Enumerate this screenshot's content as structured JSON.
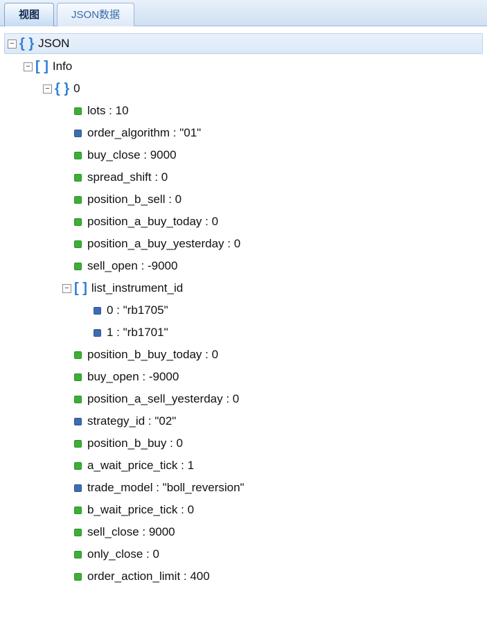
{
  "tabs": {
    "view": "视图",
    "json_data": "JSON数据"
  },
  "tree": {
    "root_label": "JSON",
    "info_label": "Info",
    "index0_label": "0",
    "list_instrument_label": "list_instrument_id",
    "items_top": [
      {
        "key": "lots",
        "value": "10",
        "type": "number"
      },
      {
        "key": "order_algorithm",
        "value": "\"01\"",
        "type": "string"
      },
      {
        "key": "buy_close",
        "value": "9000",
        "type": "number"
      },
      {
        "key": "spread_shift",
        "value": "0",
        "type": "number"
      },
      {
        "key": "position_b_sell",
        "value": "0",
        "type": "number"
      },
      {
        "key": "position_a_buy_today",
        "value": "0",
        "type": "number"
      },
      {
        "key": "position_a_buy_yesterday",
        "value": "0",
        "type": "number"
      },
      {
        "key": "sell_open",
        "value": "-9000",
        "type": "number"
      }
    ],
    "list_instrument_items": [
      {
        "key": "0",
        "value": "\"rb1705\"",
        "type": "string"
      },
      {
        "key": "1",
        "value": "\"rb1701\"",
        "type": "string"
      }
    ],
    "items_bottom": [
      {
        "key": "position_b_buy_today",
        "value": "0",
        "type": "number"
      },
      {
        "key": "buy_open",
        "value": "-9000",
        "type": "number"
      },
      {
        "key": "position_a_sell_yesterday",
        "value": "0",
        "type": "number"
      },
      {
        "key": "strategy_id",
        "value": "\"02\"",
        "type": "string"
      },
      {
        "key": "position_b_buy",
        "value": "0",
        "type": "number"
      },
      {
        "key": "a_wait_price_tick",
        "value": "1",
        "type": "number"
      },
      {
        "key": "trade_model",
        "value": "\"boll_reversion\"",
        "type": "string"
      },
      {
        "key": "b_wait_price_tick",
        "value": "0",
        "type": "number"
      },
      {
        "key": "sell_close",
        "value": "9000",
        "type": "number"
      },
      {
        "key": "only_close",
        "value": "0",
        "type": "number"
      },
      {
        "key": "order_action_limit",
        "value": "400",
        "type": "number"
      }
    ]
  }
}
